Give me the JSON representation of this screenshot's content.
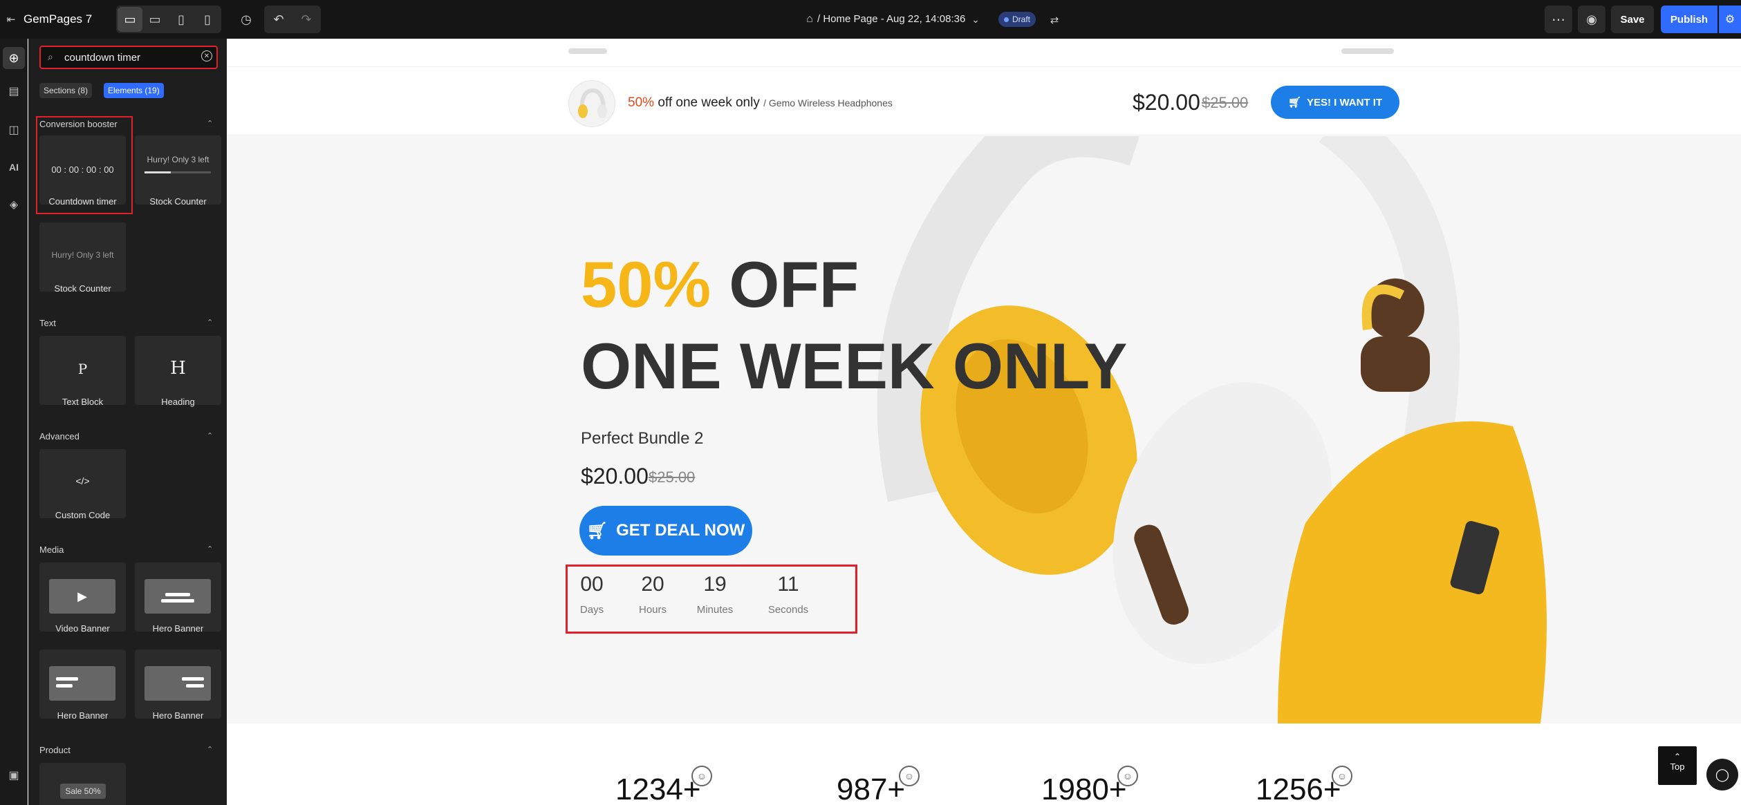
{
  "topbar": {
    "app_name": "GemPages 7",
    "page_title": "/ Home Page - Aug 22, 14:08:36",
    "draft_badge": "Draft",
    "save_label": "Save",
    "publish_label": "Publish"
  },
  "sidebar": {
    "search_value": "countdown timer",
    "tab_sections": "Sections (8)",
    "tab_elements": "Elements (19)",
    "groups": {
      "conversion": "Conversion booster",
      "text": "Text",
      "advanced": "Advanced",
      "media": "Media",
      "product": "Product"
    },
    "tiles": {
      "countdown_preview": "00 : 00 : 00 : 00",
      "countdown_label": "Countdown timer",
      "stock_preview": "Hurry! Only 3 left",
      "stock_label": "Stock Counter",
      "stock2_preview": "Hurry! Only 3 left",
      "stock2_label": "Stock Counter",
      "text_block_glyph": "P",
      "text_block_label": "Text Block",
      "heading_glyph": "H",
      "heading_label": "Heading",
      "custom_code_glyph": "</>",
      "custom_code_label": "Custom Code",
      "video_banner_label": "Video Banner",
      "hero_banner_label_1": "Hero Banner",
      "hero_banner_label_2": "Hero Banner",
      "hero_banner_label_3": "Hero Banner",
      "sale_preview": "Sale 50%"
    }
  },
  "page": {
    "sticky": {
      "percent": "50%",
      "offer_text": "off one week only",
      "product_name": "/ Gemo Wireless Headphones",
      "price": "$20.00",
      "compare_price": "$25.00",
      "cta": "YES! I WANT IT"
    },
    "hero": {
      "headline_percent": "50%",
      "headline_off": "OFF",
      "headline_line2": "ONE WEEK ONLY",
      "subtitle": "Perfect Bundle 2",
      "price": "$20.00",
      "compare_price": "$25.00",
      "cta": "GET DEAL NOW",
      "countdown": [
        {
          "value": "00",
          "label": "Days"
        },
        {
          "value": "20",
          "label": "Hours"
        },
        {
          "value": "19",
          "label": "Minutes"
        },
        {
          "value": "11",
          "label": "Seconds"
        }
      ]
    },
    "stats": [
      "1234+",
      "987+",
      "1980+",
      "1256+"
    ],
    "top_button": "Top"
  },
  "colors": {
    "accent_blue": "#1e7ee8",
    "publish_blue": "#2f6bff",
    "highlight_red": "#e0202a",
    "yellow": "#f6b618"
  }
}
